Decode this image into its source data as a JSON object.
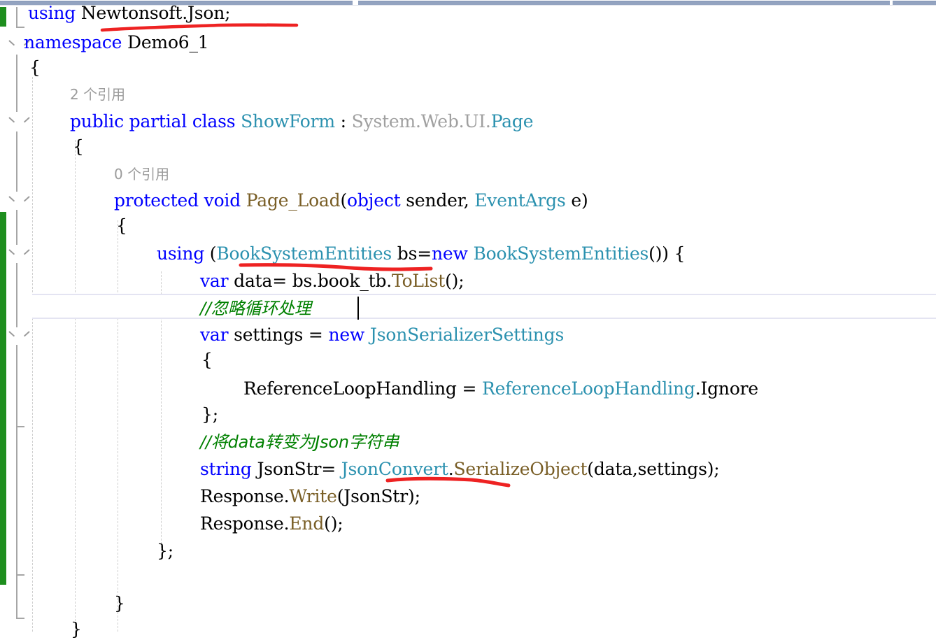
{
  "app": {
    "kind": "code-editor",
    "language": "C#",
    "theme": "light"
  },
  "colors": {
    "background": "#ffffff",
    "keyword": "#0000ff",
    "type": "#2b91af",
    "comment": "#008000",
    "method": "#795e26",
    "grayed_out": "#a0a0a0",
    "change_bar": "#1e8e1e",
    "current_line_border": "#e4e4f2",
    "annotation_red": "#ee2222",
    "indent_guide": "#cfcfcf",
    "splitter": "#93a3c0"
  },
  "codelens": [
    {
      "id": "class-refs",
      "text": "2 个引用"
    },
    {
      "id": "method-refs",
      "text": "0 个引用"
    }
  ],
  "code": {
    "line01": {
      "kw1": "using",
      "rest": " Newtonsoft.Json;"
    },
    "line02": {
      "kw1": "namespace",
      "rest": " Demo6_1"
    },
    "line03": {
      "text": "{"
    },
    "line04": {
      "kw1": "public",
      "sp1": " ",
      "kw2": "partial",
      "sp2": " ",
      "kw3": "class",
      "sp3": " ",
      "type1": "ShowForm",
      "colon": " : ",
      "gray1": "System.Web.UI.",
      "type2": "Page"
    },
    "line05": {
      "text": "{"
    },
    "line06": {
      "kw1": "protected",
      "sp1": " ",
      "kw2": "void",
      "sp2": " ",
      "mth1": "Page_Load",
      "p1": "(",
      "kw3": "object",
      "sp3": " ",
      "plain1": "sender, ",
      "type1": "EventArgs",
      "plain2": " e)"
    },
    "line07": {
      "text": "{"
    },
    "line08": {
      "kw1": "using",
      "p1": " (",
      "type1": "BookSystemEntities",
      "plain1": " bs=",
      "kw2": "new",
      "plain2": " ",
      "type2": "BookSystemEntities",
      "plain3": "()) {"
    },
    "line09": {
      "kw1": "var",
      "plain1": " data= bs.book_tb.",
      "mth1": "ToList",
      "plain2": "();"
    },
    "line10": {
      "cmt": "//忽略循环处理"
    },
    "line11": {
      "kw1": "var",
      "plain1": " settings = ",
      "kw2": "new",
      "plain2": " ",
      "type1": "JsonSerializerSettings"
    },
    "line12": {
      "text": "{"
    },
    "line13": {
      "plain1": "ReferenceLoopHandling = ",
      "type1": "ReferenceLoopHandling",
      "plain2": ".Ignore"
    },
    "line14": {
      "text": "};"
    },
    "line15": {
      "cmt": "//将data转变为Json字符串"
    },
    "line16": {
      "kw1": "string",
      "plain1": " JsonStr= ",
      "type1": "JsonConvert",
      "plain2": ".",
      "mth1": "SerializeObject",
      "plain3": "(data,settings);"
    },
    "line17": {
      "plain1": "Response.",
      "mth1": "Write",
      "plain2": "(JsonStr);"
    },
    "line18": {
      "plain1": "Response.",
      "mth1": "End",
      "plain2": "();"
    },
    "line19": {
      "text": "};"
    },
    "line20": {
      "text": "}"
    },
    "line21": {
      "text": "}"
    }
  },
  "annotations": {
    "underline1": {
      "label": "red-underline-newtonsoft-json"
    },
    "underline2": {
      "label": "red-underline-booksystementities"
    },
    "underline3": {
      "label": "red-underline-jsonconvert"
    }
  },
  "caret": {
    "label": "text-cursor",
    "line": 10
  }
}
